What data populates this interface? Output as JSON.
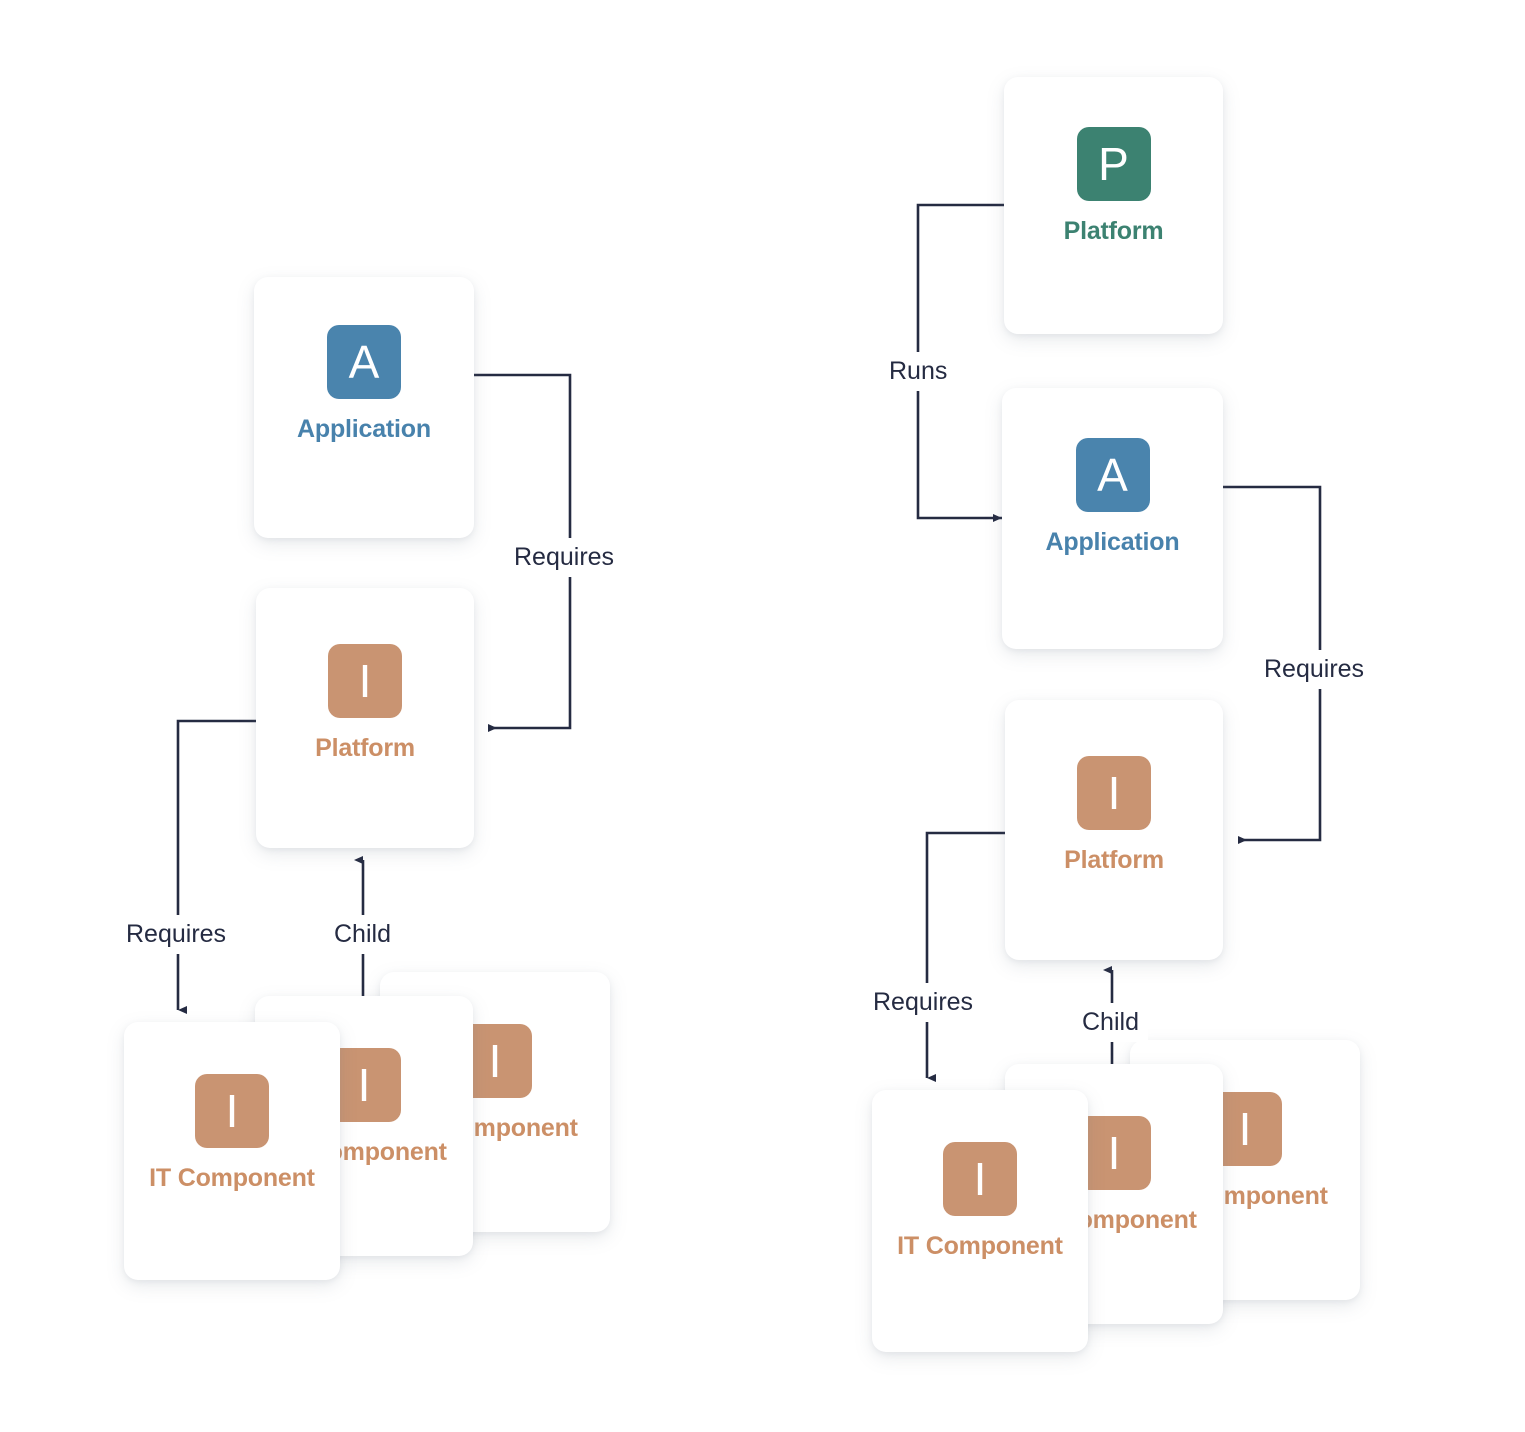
{
  "colors": {
    "application": "#4A84AD",
    "application_text": "#4882AC",
    "platform_it": "#C99472",
    "platform_it_text": "#CC8F66",
    "platform_p": "#3C8271",
    "platform_p_text": "#3C8271",
    "connector": "#252B42",
    "label_text": "#252B42",
    "card_background": "#FFFFFF",
    "page_background": "#FFFFFF"
  },
  "diagrams": [
    {
      "id": "left-diagram",
      "nodes": {
        "application": {
          "icon_letter": "A",
          "label": "Application",
          "icon_name": "application-icon"
        },
        "platform": {
          "icon_letter": "I",
          "label": "Platform",
          "icon_name": "platform-icon"
        },
        "it_components": [
          {
            "icon_letter": "I",
            "label": "IT Component",
            "icon_name": "it-component-icon"
          },
          {
            "icon_letter": "I",
            "label": "IT Component",
            "icon_name": "it-component-icon"
          },
          {
            "icon_letter": "I",
            "label": "IT Component",
            "icon_name": "it-component-icon"
          }
        ]
      },
      "edges": [
        {
          "label": "Requires",
          "from": "application",
          "to": "platform"
        },
        {
          "label": "Requires",
          "from": "platform",
          "to": "it_component"
        },
        {
          "label": "Child",
          "from": "it_component",
          "to": "platform"
        }
      ]
    },
    {
      "id": "right-diagram",
      "nodes": {
        "platform_p": {
          "icon_letter": "P",
          "label": "Platform",
          "icon_name": "platform-p-icon"
        },
        "application": {
          "icon_letter": "A",
          "label": "Application",
          "icon_name": "application-icon"
        },
        "platform": {
          "icon_letter": "I",
          "label": "Platform",
          "icon_name": "platform-icon"
        },
        "it_components": [
          {
            "icon_letter": "I",
            "label": "IT Component",
            "icon_name": "it-component-icon"
          },
          {
            "icon_letter": "I",
            "label": "IT Component",
            "icon_name": "it-component-icon"
          },
          {
            "icon_letter": "I",
            "label": "IT Component",
            "icon_name": "it-component-icon"
          }
        ]
      },
      "edges": [
        {
          "label": "Runs",
          "from": "platform_p",
          "to": "application"
        },
        {
          "label": "Requires",
          "from": "application",
          "to": "platform"
        },
        {
          "label": "Requires",
          "from": "platform",
          "to": "it_component"
        },
        {
          "label": "Child",
          "from": "it_component",
          "to": "platform"
        }
      ]
    }
  ]
}
